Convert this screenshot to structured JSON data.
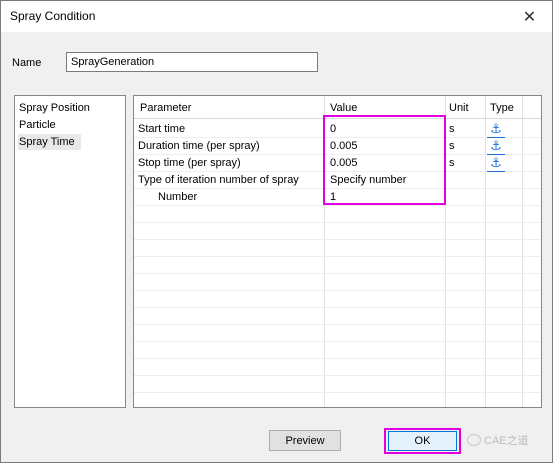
{
  "window": {
    "title": "Spray Condition",
    "close_glyph": "✕"
  },
  "name_field": {
    "label": "Name",
    "value": "SprayGeneration"
  },
  "sidebar": {
    "items": [
      {
        "label": "Spray Position",
        "selected": false
      },
      {
        "label": "Particle",
        "selected": false
      },
      {
        "label": "Spray Time",
        "selected": true
      }
    ]
  },
  "grid": {
    "columns": [
      "Parameter",
      "Value",
      "Unit",
      "Type"
    ],
    "rows": [
      {
        "parameter": "Start time",
        "value": "0",
        "unit": "s",
        "type_icon": "anchor-icon"
      },
      {
        "parameter": "Duration time (per spray)",
        "value": "0.005",
        "unit": "s",
        "type_icon": "anchor-icon"
      },
      {
        "parameter": "Stop time (per spray)",
        "value": "0.005",
        "unit": "s",
        "type_icon": "anchor-icon"
      },
      {
        "parameter": "Type of iteration number of spray",
        "value": "Specify number",
        "unit": "",
        "type_icon": ""
      },
      {
        "parameter": "Number",
        "value": "1",
        "unit": "",
        "type_icon": ""
      }
    ]
  },
  "buttons": {
    "preview": "Preview",
    "ok": "OK"
  },
  "watermark": {
    "text": "CAE之道"
  },
  "colors": {
    "highlight": "#e000e0",
    "link_icon": "#1e6fd9"
  }
}
